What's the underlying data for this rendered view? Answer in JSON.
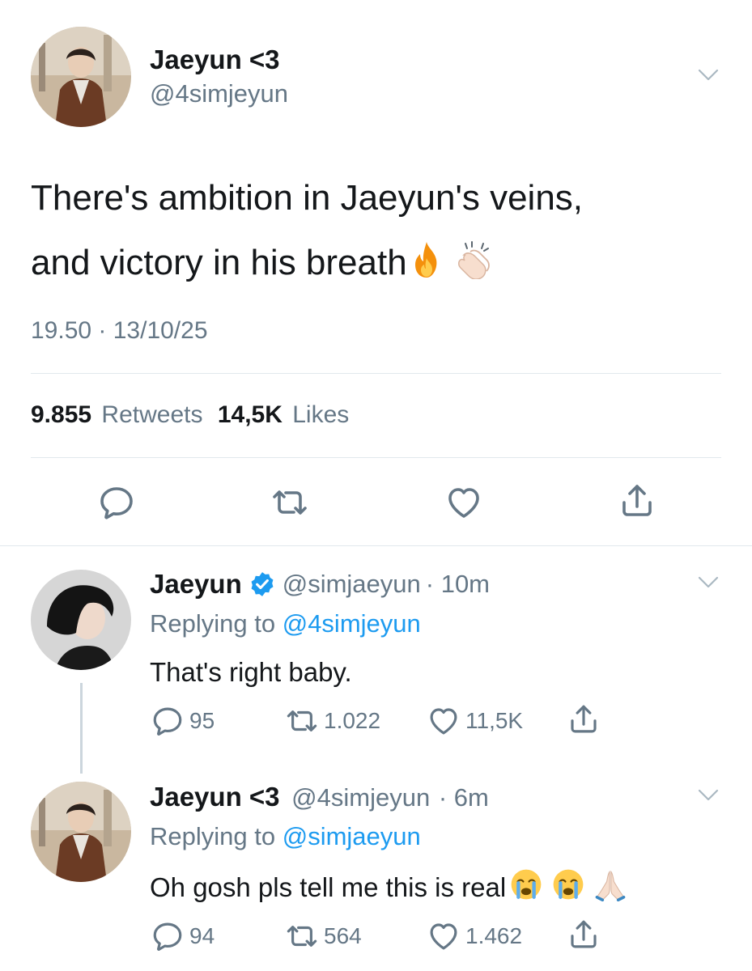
{
  "main_tweet": {
    "display_name": "Jaeyun <3",
    "handle": "@4simjeyun",
    "text_line1": "There's ambition in Jaeyun's veins,",
    "text_line2": "and victory in his breath",
    "emojis": [
      "fire-icon",
      "clapping-hands-icon"
    ],
    "time": "19.50 · 13/10/25",
    "retweet_count": "9.855",
    "retweet_label": "Retweets",
    "like_count": "14,5K",
    "like_label": "Likes"
  },
  "replies": [
    {
      "display_name": "Jaeyun",
      "verified": true,
      "handle": "@simjaeyun",
      "age": "· 10m",
      "replying_prefix": "Replying to",
      "replying_handle": "@4simjeyun",
      "text": "That's right baby.",
      "reply_count": "95",
      "retweet_count": "1.022",
      "like_count": "11,5K"
    },
    {
      "display_name": "Jaeyun <3",
      "verified": false,
      "handle": "@4simjeyun",
      "age": "· 6m",
      "replying_prefix": "Replying to",
      "replying_handle": "@simjaeyun",
      "text": "Oh gosh pls tell me this is real",
      "emojis": [
        "loudly-crying-face-icon",
        "loudly-crying-face-icon",
        "folded-hands-icon"
      ],
      "reply_count": "94",
      "retweet_count": "564",
      "like_count": "1.462"
    }
  ],
  "colors": {
    "accent": "#1d9bf0",
    "secondary_text": "#657786",
    "divider": "#e1e8ed"
  }
}
